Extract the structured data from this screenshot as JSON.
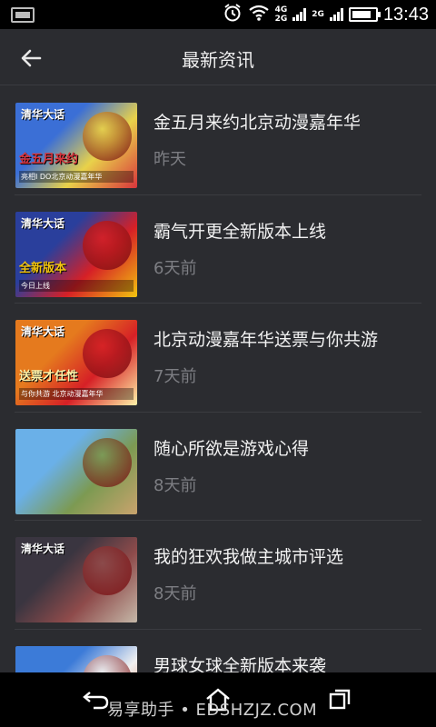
{
  "status_bar": {
    "net_top": "4G",
    "net_bottom": "2G",
    "net2": "2G",
    "time": "13:43",
    "battery_level": 0.85
  },
  "header": {
    "title": "最新资讯",
    "back_icon": "arrow-left-icon"
  },
  "news": [
    {
      "title": "金五月来约北京动漫嘉年华",
      "time": "昨天",
      "thumb": {
        "colors": [
          "#3b6fd6",
          "#e9d24a",
          "#d8343c"
        ],
        "caption": "金五月来约",
        "subcaption": "亮相I DO北京动漫嘉年华",
        "logo": "清华大话"
      }
    },
    {
      "title": "霸气开更全新版本上线",
      "time": "6天前",
      "thumb": {
        "colors": [
          "#2a3f9c",
          "#d62026",
          "#f2c40f"
        ],
        "caption": "全新版本",
        "subcaption": "今日上线",
        "logo": "清华大话"
      }
    },
    {
      "title": "北京动漫嘉年华送票与你共游",
      "time": "7天前",
      "thumb": {
        "colors": [
          "#e57a1e",
          "#d62026",
          "#fff2a8"
        ],
        "caption": "送票才任性",
        "subcaption": "与你共游 北京动漫嘉年华",
        "logo": "清华大话"
      }
    },
    {
      "title": "随心所欲是游戏心得",
      "time": "8天前",
      "thumb": {
        "colors": [
          "#6ab0e8",
          "#7c9a52",
          "#c9a36d"
        ]
      }
    },
    {
      "title": "我的狂欢我做主城市评选",
      "time": "8天前",
      "thumb": {
        "colors": [
          "#3a3540",
          "#8e4b4b",
          "#c5b8a8"
        ],
        "logo": "清华大话"
      }
    },
    {
      "title": "男球女球全新版本来袭",
      "time": "",
      "thumb": {
        "colors": [
          "#3c7bd8",
          "#f0f0f0",
          "#e06a3a"
        ]
      }
    }
  ],
  "nav": {
    "back_icon": "nav-back-icon",
    "home_icon": "nav-home-icon",
    "recents_icon": "nav-recents-icon",
    "watermark": "易享助手 • EDSHZJZ.COM"
  }
}
